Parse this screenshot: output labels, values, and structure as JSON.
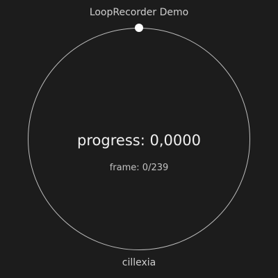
{
  "header": {
    "title": "LoopRecorder Demo"
  },
  "animation": {
    "progress": 0,
    "progress_text": "progress: 0,0000",
    "frame_text": "frame: 0/239"
  },
  "footer": {
    "author": "cillexia"
  },
  "colors": {
    "background": "#1c1c1c",
    "ring": "#bdbdbd",
    "marker": "#ffffff",
    "text": "#d6d6d6"
  }
}
